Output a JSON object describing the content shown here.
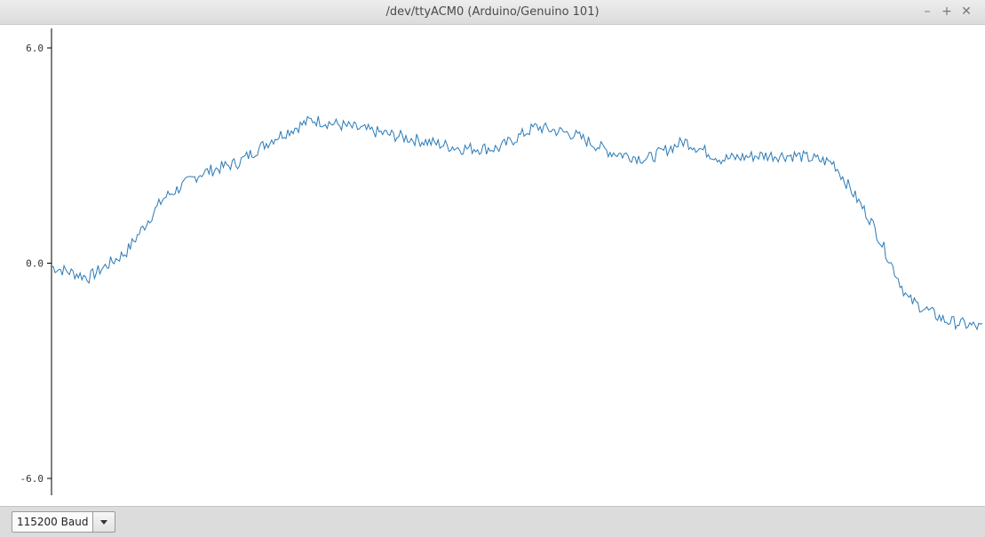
{
  "window": {
    "title": "/dev/ttyACM0 (Arduino/Genuino 101)",
    "controls": {
      "minimize": "–",
      "maximize": "+",
      "close": "✕"
    }
  },
  "chart_data": {
    "type": "line",
    "title": "",
    "xlabel": "",
    "ylabel": "",
    "ylim": [
      -6.0,
      6.0
    ],
    "yticks": [
      "6.0",
      "0.0",
      "-6.0"
    ],
    "grid": false,
    "series": [
      {
        "color": "#2a7ab7",
        "x": [
          0,
          20,
          40,
          60,
          80,
          100,
          120,
          140,
          160,
          180,
          200,
          220,
          240,
          260,
          280,
          300,
          320,
          340,
          360,
          380,
          400,
          420,
          440,
          460,
          480,
          500
        ],
        "y": [
          -0.1,
          -0.4,
          0.3,
          1.8,
          2.5,
          2.8,
          3.5,
          4.0,
          3.8,
          3.6,
          3.4,
          3.2,
          3.2,
          3.8,
          3.6,
          3.1,
          2.9,
          3.4,
          2.9,
          3.0,
          3.0,
          2.8,
          1.2,
          -1.0,
          -1.6,
          -1.8
        ]
      }
    ]
  },
  "footer": {
    "baud_label": "115200 Baud"
  }
}
